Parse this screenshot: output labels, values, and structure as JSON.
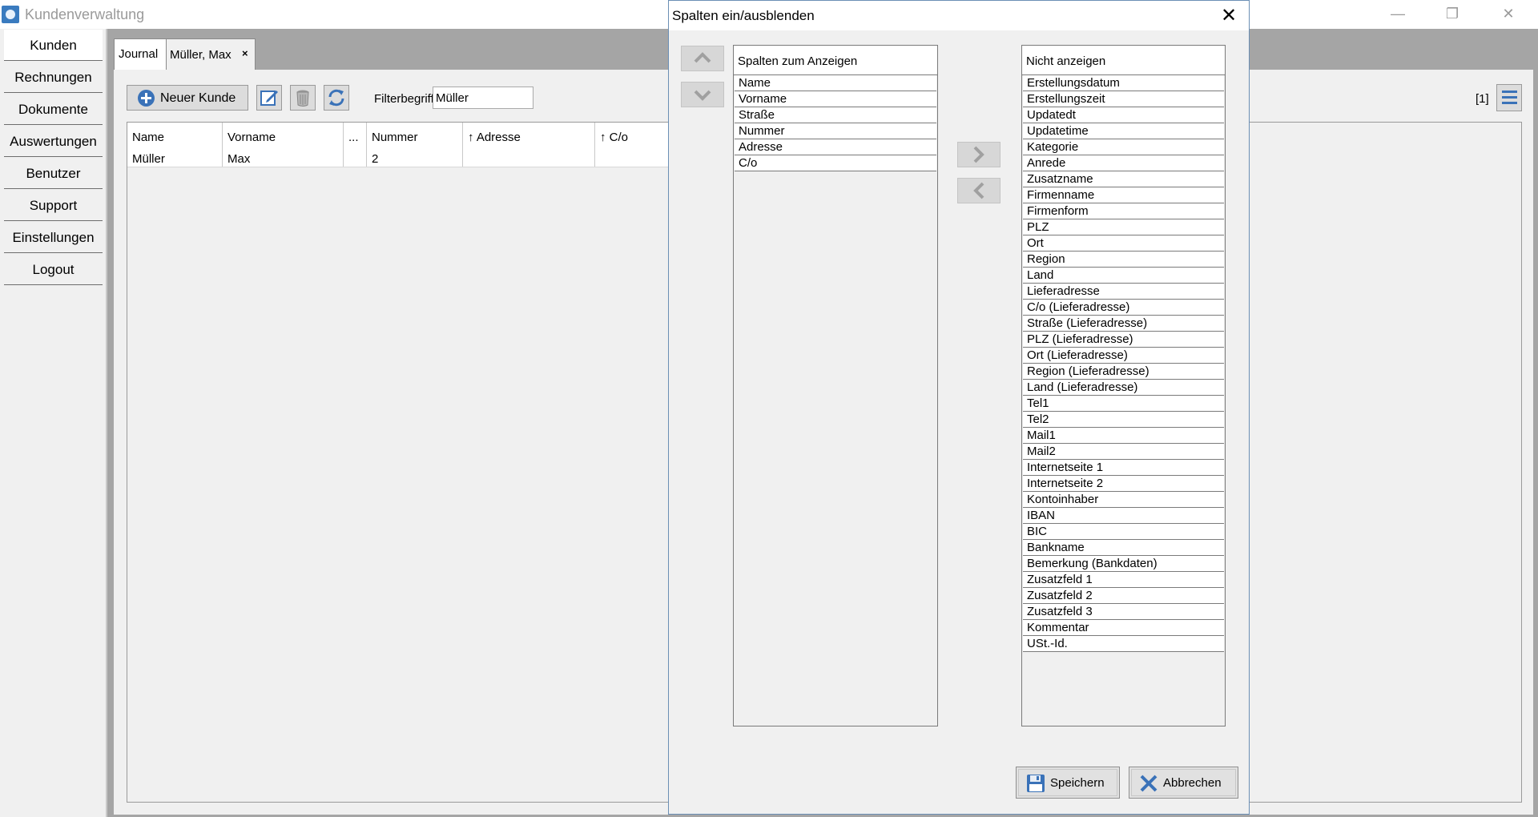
{
  "window": {
    "title": "Kundenverwaltung"
  },
  "sidebar": {
    "items": [
      {
        "label": "Kunden"
      },
      {
        "label": "Rechnungen"
      },
      {
        "label": "Dokumente"
      },
      {
        "label": "Auswertungen"
      },
      {
        "label": "Benutzer"
      },
      {
        "label": "Support"
      },
      {
        "label": "Einstellungen"
      },
      {
        "label": "Logout"
      }
    ]
  },
  "tabs": [
    {
      "label": "Journal"
    },
    {
      "label": "Müller, Max",
      "close": "×"
    }
  ],
  "toolbar": {
    "new_customer_label": "Neuer Kunde",
    "filter_label": "Filterbegriff:",
    "filter_value": "Müller",
    "count_badge": "[1]",
    "icons": [
      "plus-circle-icon",
      "edit-icon",
      "trash-icon",
      "refresh-icon",
      "hamburger-menu-icon"
    ]
  },
  "table": {
    "columns": [
      "Name",
      "Vorname",
      "...",
      "Nummer",
      "↑ Adresse",
      "↑ C/o"
    ],
    "rows": [
      [
        "Müller",
        "Max",
        "",
        "2",
        "",
        ""
      ]
    ]
  },
  "dialog": {
    "title": "Spalten ein/ausblenden",
    "close": "✕",
    "shown_header": "Spalten zum Anzeigen",
    "shown": [
      "Name",
      "Vorname",
      "Straße",
      "Nummer",
      "Adresse",
      "C/o"
    ],
    "hidden_header": "Nicht anzeigen",
    "hidden": [
      "Erstellungsdatum",
      "Erstellungszeit",
      "Updatedt",
      "Updatetime",
      "Kategorie",
      "Anrede",
      "Zusatzname",
      "Firmenname",
      "Firmenform",
      "PLZ",
      "Ort",
      "Region",
      "Land",
      "Lieferadresse",
      "C/o (Lieferadresse)",
      "Straße (Lieferadresse)",
      "PLZ (Lieferadresse)",
      "Ort (Lieferadresse)",
      "Region (Lieferadresse)",
      "Land (Lieferadresse)",
      "Tel1",
      "Tel2",
      "Mail1",
      "Mail2",
      "Internetseite 1",
      "Internetseite 2",
      "Kontoinhaber",
      "IBAN",
      "BIC",
      "Bankname",
      "Bemerkung (Bankdaten)",
      "Zusatzfeld 1",
      "Zusatzfeld 2",
      "Zusatzfeld 3",
      "Kommentar",
      "USt.-Id."
    ],
    "save_label": "Speichern",
    "cancel_label": "Abbrechen"
  },
  "colors": {
    "accent": "#3a72b8",
    "disabled_arrow": "#a0a0a0"
  }
}
